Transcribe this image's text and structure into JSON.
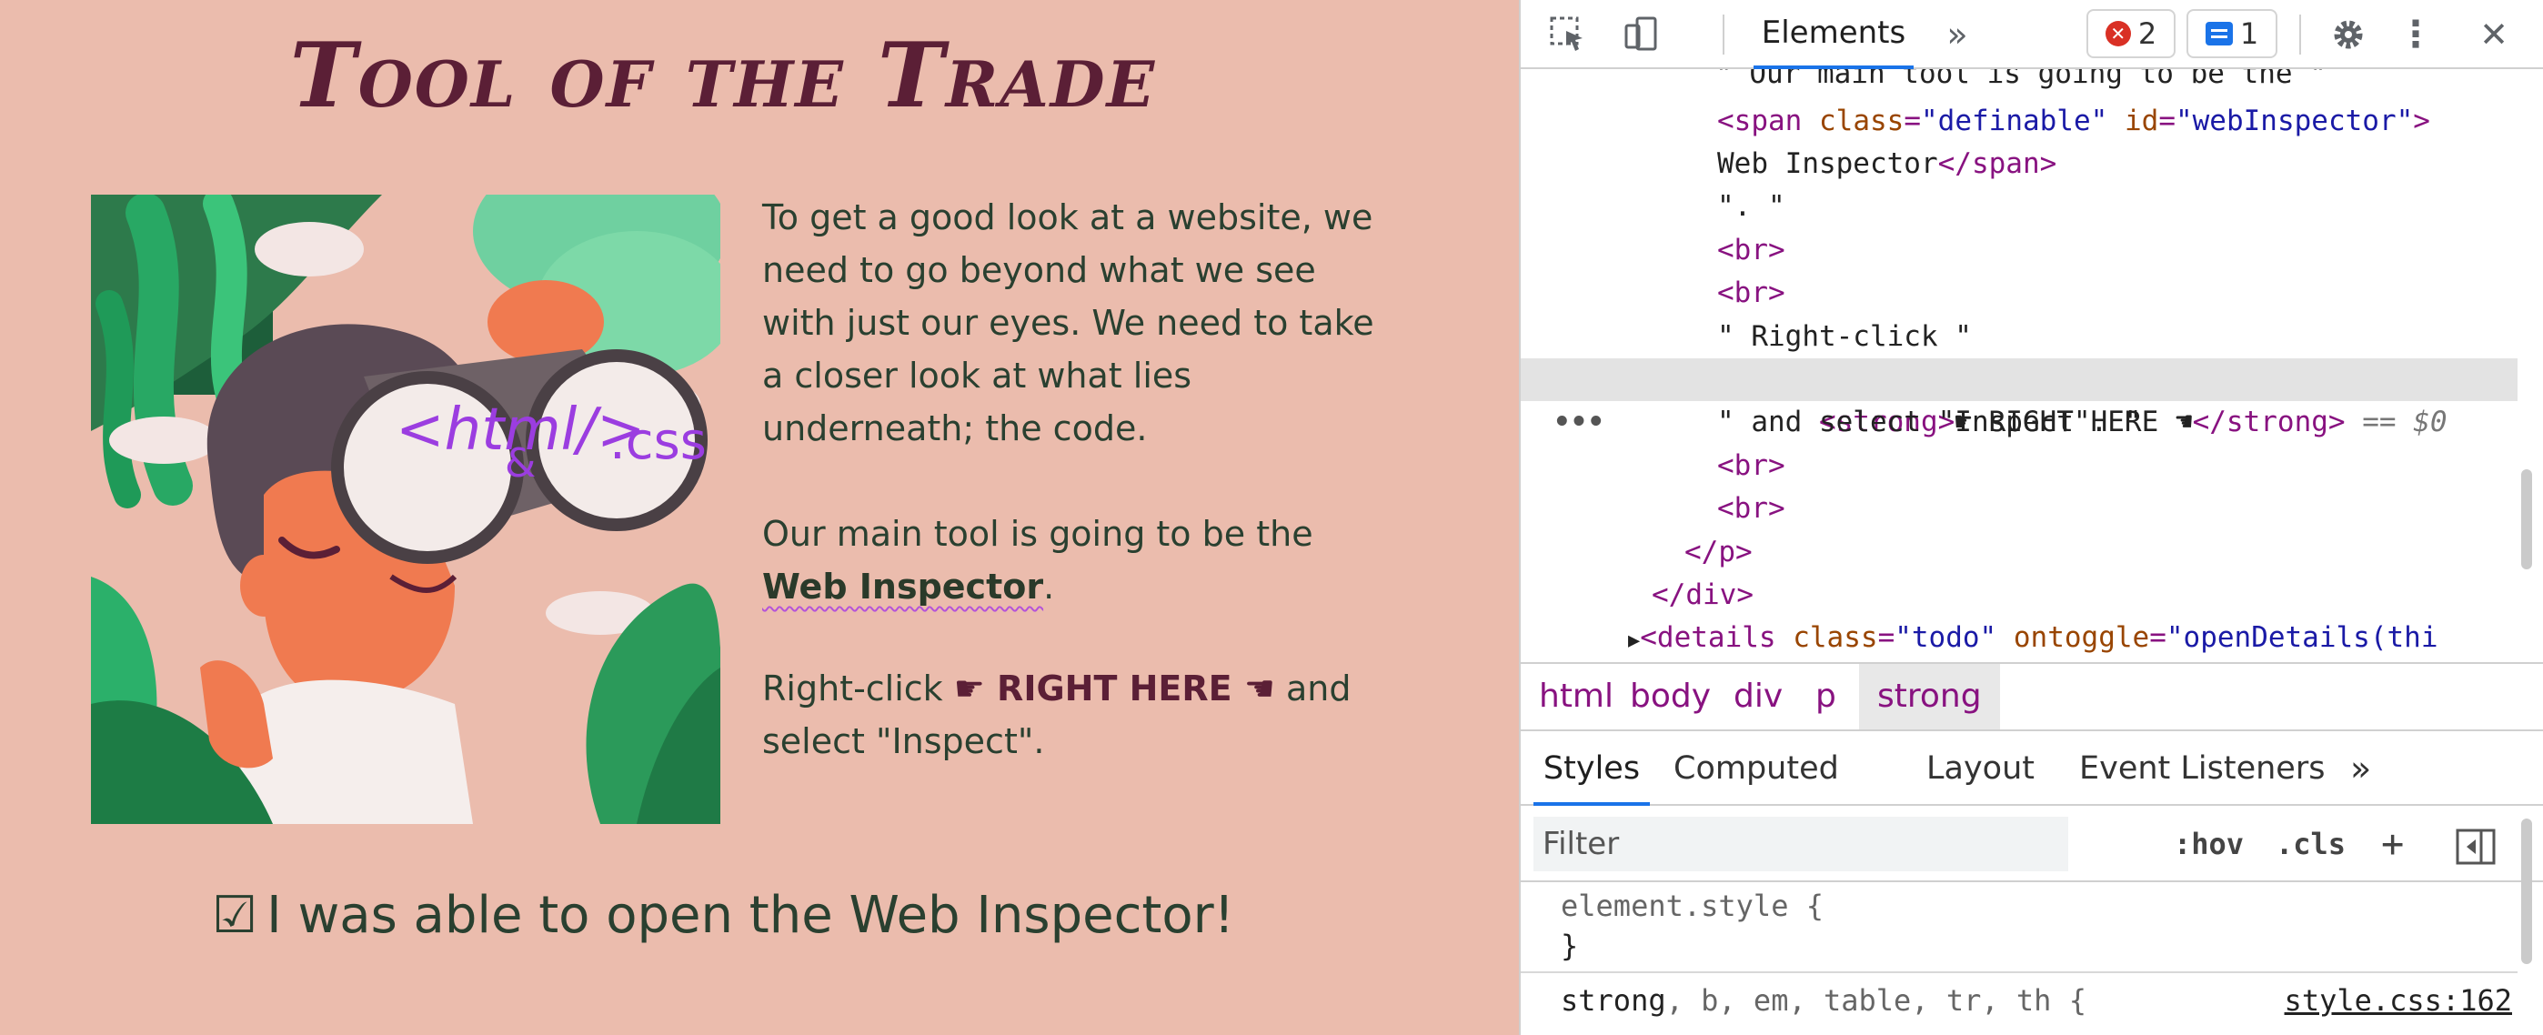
{
  "page": {
    "title": "Tool of the Trade",
    "para1": "To get a good look at a website, we need to go beyond what we see with just our eyes. We need to take a closer look at what lies underneath; the code.",
    "para2_before": "Our main tool is going to be the ",
    "para2_link": "Web Inspector",
    "para2_after": ".",
    "para3_before": "Right-click ",
    "para3_strong": "☛ RIGHT HERE ☚",
    "para3_after": " and select \"Inspect\".",
    "todo_checkbox": "☑",
    "todo_label": "I was able to open the Web Inspector!",
    "illustration": {
      "tag_html": "<html/>",
      "amp": "&",
      "css": ".css"
    },
    "colors": {
      "page_bg": "#ebbcad",
      "title": "#5b1f36",
      "text": "#2a4030",
      "accent_green": "#2d8a52",
      "link_underline": "#b453d9"
    }
  },
  "devtools": {
    "toolbar": {
      "inspect_icon": "inspect-element-icon",
      "device_icon": "device-toolbar-icon",
      "active_tab": "Elements",
      "more_tabs": "»",
      "error_count": "2",
      "error_glyph": "✕",
      "message_count": "1",
      "settings_icon": "gear-icon",
      "menu_icon": "⋮",
      "close_icon": "✕"
    },
    "dom": {
      "line1": "\" Our main tool is going to be the \"",
      "line2_tag_open": "<span",
      "line2_attr1": "class",
      "line2_val1": "\"definable\"",
      "line2_attr2": "id",
      "line2_val2": "\"webInspector\"",
      "line2_close": ">",
      "line3_text": "Web Inspector",
      "line3_tag": "</span>",
      "line4": "\". \"",
      "br": "<br>",
      "line7": "\" Right-click \"",
      "line8_dots": "•••",
      "line8_open": "<strong>",
      "line8_text": "☛ RIGHT HERE ☚",
      "line8_close": "</strong>",
      "line8_ref": " == $0",
      "line9": "\" and select \"Inspect\". \"",
      "close_p": "</p>",
      "close_div": "</div>",
      "details_arrow": "▶",
      "details_open": "<details",
      "details_attr1": "class",
      "details_val1": "\"todo\"",
      "details_attr2": "ontoggle",
      "details_val2": "\"openDetails(thi"
    },
    "breadcrumbs": [
      "html",
      "body",
      "div",
      "p",
      "strong"
    ],
    "styles_tabs": [
      "Styles",
      "Computed",
      "Layout",
      "Event Listeners",
      "»"
    ],
    "filter": {
      "placeholder": "Filter",
      "hov": ":hov",
      "cls": ".cls",
      "add": "+",
      "toggle_icon": "sidebar-toggle-icon"
    },
    "rules": {
      "element_style": "element.style {",
      "close_brace": "}",
      "rule2_sel1": "strong",
      "rule2_rest": ", b, em, table, tr, th {",
      "rule2_link": "style.css:162"
    }
  }
}
